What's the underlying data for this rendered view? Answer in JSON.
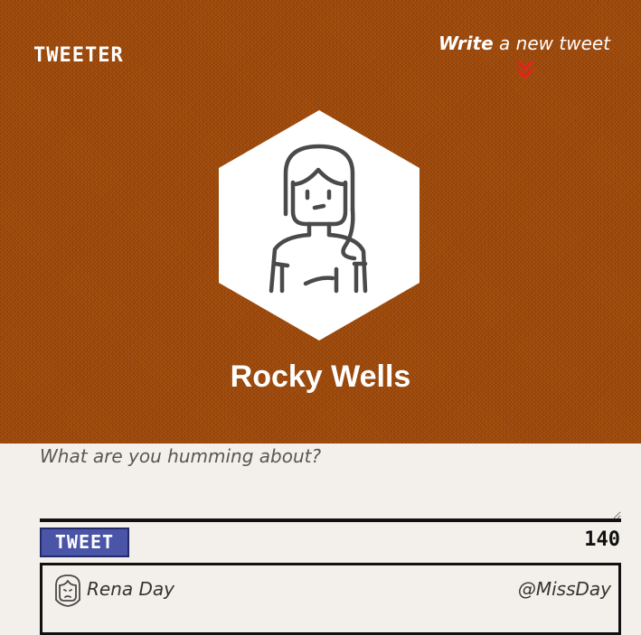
{
  "nav": {
    "brand": "TWEETER",
    "write_bold": "Write",
    "write_rest": " a new tweet",
    "chevron_icon": "double-chevron-down-icon",
    "chevron_color": "#e0251b"
  },
  "profile": {
    "name": "Rocky Wells",
    "avatar_icon": "woman-avatar-icon"
  },
  "compose": {
    "placeholder": "What are you humming about?",
    "value": "",
    "tweet_button": "TWEET",
    "counter": "140"
  },
  "tweets": [
    {
      "name": "Rena Day",
      "handle": "@MissDay",
      "avatar_icon": "sad-woman-avatar-icon"
    }
  ],
  "colors": {
    "header_bg": "#a04a0c",
    "button_bg": "#4a55a8",
    "page_bg": "#f3f0eb"
  }
}
